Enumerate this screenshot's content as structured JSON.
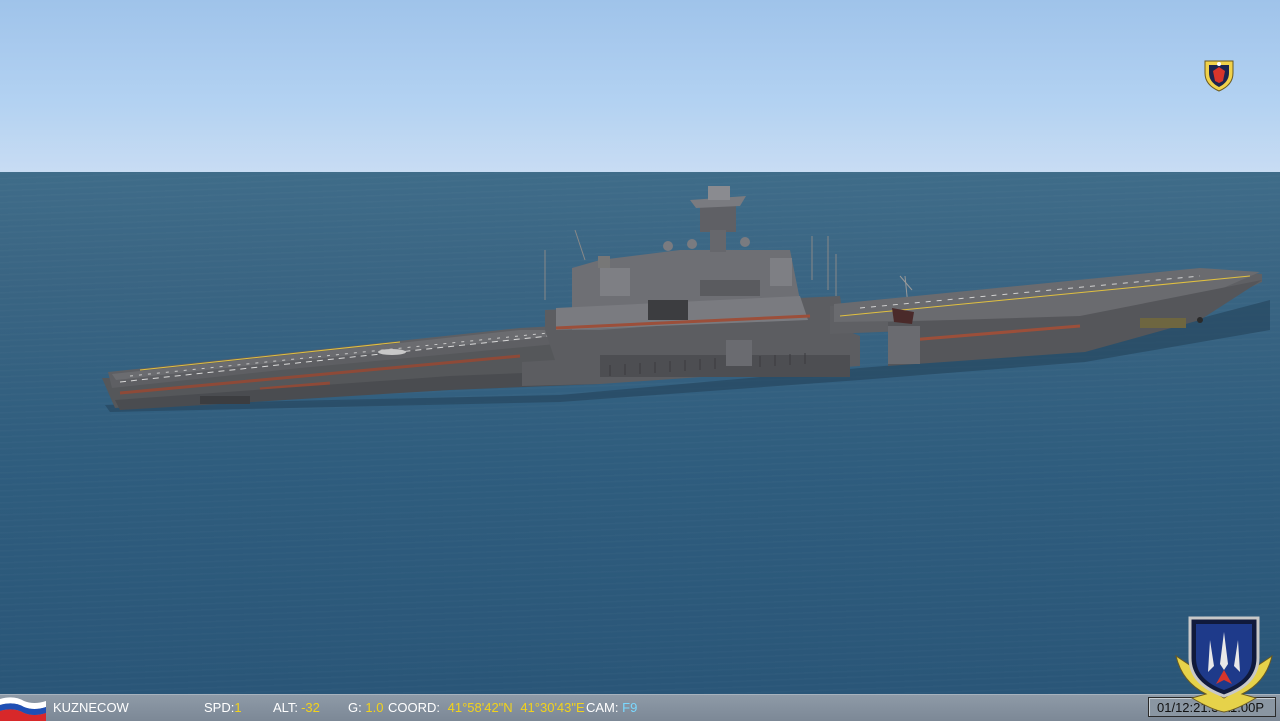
{
  "hud": {
    "ship_name": "KUZNECOW",
    "spd_label": "SPD:",
    "spd_value": "1",
    "alt_label": "ALT:",
    "alt_value": "-32",
    "g_label": "G:",
    "g_value": "1.0",
    "coord_label": "COORD:",
    "lat_value": "41°58'42\"N",
    "lon_value": "41°30'43\"E",
    "cam_label": "CAM:",
    "cam_value": "F9",
    "clock": "01/12:21:3  A1.00P"
  },
  "icons": {
    "flag": "russian-flag-icon",
    "emblem_top": "squadron-shield-icon",
    "emblem_bottom": "wing-crest-icon"
  },
  "colors": {
    "value_yellow": "#f2d21a",
    "cam_blue": "#7ad8ff",
    "hud_bar": "#8594a2"
  }
}
